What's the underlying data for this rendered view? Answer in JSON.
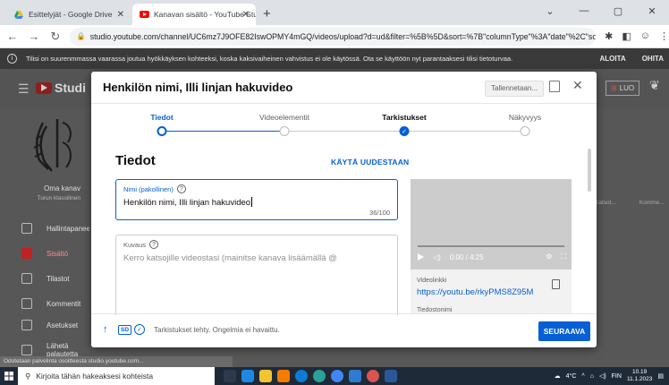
{
  "browser": {
    "tabs": [
      {
        "label": "Esittelyjät - Google Drive",
        "active": false
      },
      {
        "label": "Kanavan sisältö - YouTube Studio",
        "active": true
      }
    ],
    "new_tab_glyph": "+",
    "url": "studio.youtube.com/channel/UC6mz7J9OFE82IswOPMY4mGQ/videos/upload?d=ud&filter=%5B%5D&sort=%7B\"columnType\"%3A\"date\"%2C\"sortOr...",
    "window_controls": [
      "⌄",
      "—",
      "▢",
      "✕"
    ]
  },
  "warning_bar": {
    "text": "Tilisi on suurenmmassa vaarassa joutua hyökkäyksen kohteeksi, koska kaksivaiheinen vahvistus ei ole käytössä. Ota se käyttöön nyt parantaaksesi tilisi tietoturvaa.",
    "actions": [
      "ALOITA",
      "OHITA"
    ]
  },
  "studio": {
    "logo_text": "Studi",
    "create_label": "LUO",
    "channel_name": "Oma kanav",
    "channel_sub": "Turun klassilinen",
    "sidebar": [
      {
        "label": "Hallintapaneeli",
        "active": false
      },
      {
        "label": "Sisältö",
        "active": true
      },
      {
        "label": "Tilastot",
        "active": false
      },
      {
        "label": "Kommentit",
        "active": false
      },
      {
        "label": "Asetukset",
        "active": false
      },
      {
        "label": "Lähetä palautetta",
        "active": false
      }
    ],
    "bg_columns": [
      "Katsot...",
      "Komme..."
    ],
    "status_url": "Odotetaan palvelinta osoitteesta studio.youtube.com..."
  },
  "dialog": {
    "title": "Henkilön nimi, Illi linjan hakuvideo",
    "saving_label": "Tallennetaan...",
    "steps": [
      {
        "label": "Tiedot",
        "state": "current"
      },
      {
        "label": "Videoelementit",
        "state": "todo"
      },
      {
        "label": "Tarkistukset",
        "state": "done"
      },
      {
        "label": "Näkyvyys",
        "state": "todo"
      }
    ],
    "section_title": "Tiedot",
    "reuse_label": "KÄYTÄ UUDESTAAN",
    "title_field": {
      "label": "Nimi (pakollinen)",
      "value": "Henkilön nimi, Illi linjan hakuvideo",
      "count": "36/100"
    },
    "desc_field": {
      "label": "Kuvaus",
      "placeholder": "Kerro katsojille videostasi (mainitse kanava lisäämällä @"
    },
    "video": {
      "time": "0:00 / 4:25",
      "link_label": "Videolinkki",
      "link": "https://youtu.be/rkyPMS8Z95M",
      "filename_label": "Tiedostonimi"
    },
    "footer": {
      "sd_badge": "SD",
      "status": "Tarkistukset tehty. Ongelmia ei havaittu.",
      "next_label": "SEURAAVA"
    }
  },
  "taskbar": {
    "search_placeholder": "Kirjoita tähän hakeaksesi kohteista",
    "weather": "4°C",
    "lang": "FIN",
    "time": "10.19",
    "date": "11.1.2023"
  },
  "colors": {
    "accent": "#065fd4",
    "yt_red": "#ff0000",
    "taskbar": "#1f2a38"
  }
}
